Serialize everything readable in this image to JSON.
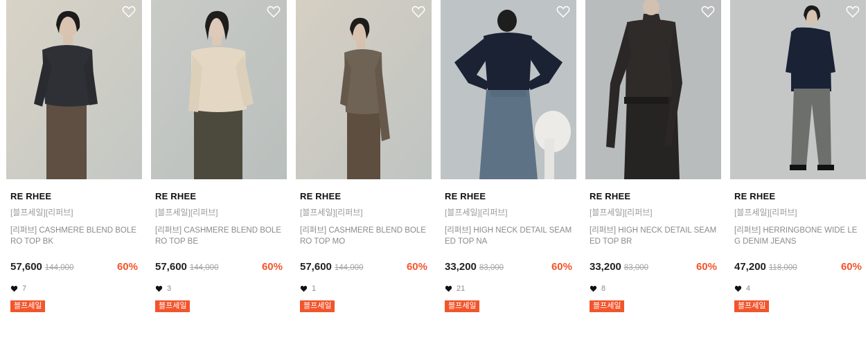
{
  "products": [
    {
      "brand": "RE RHEE",
      "tag": "[블프세일][리퍼브]",
      "name": "[리퍼브] CASHMERE BLEND BOLERO TOP BK",
      "price": "57,600",
      "original": "144,000",
      "rate": "60%",
      "likes": "7",
      "badge": "블프세일"
    },
    {
      "brand": "RE RHEE",
      "tag": "[블프세일][리퍼브]",
      "name": "[리퍼브] CASHMERE BLEND BOLERO TOP BE",
      "price": "57,600",
      "original": "144,000",
      "rate": "60%",
      "likes": "3",
      "badge": "블프세일"
    },
    {
      "brand": "RE RHEE",
      "tag": "[블프세일][리퍼브]",
      "name": "[리퍼브] CASHMERE BLEND BOLERO TOP MO",
      "price": "57,600",
      "original": "144,000",
      "rate": "60%",
      "likes": "1",
      "badge": "블프세일"
    },
    {
      "brand": "RE RHEE",
      "tag": "[블프세일][리퍼브]",
      "name": "[리퍼브] HIGH NECK DETAIL SEAMED TOP NA",
      "price": "33,200",
      "original": "83,000",
      "rate": "60%",
      "likes": "21",
      "badge": "블프세일"
    },
    {
      "brand": "RE RHEE",
      "tag": "[블프세일][리퍼브]",
      "name": "[리퍼브] HIGH NECK DETAIL SEAMED TOP BR",
      "price": "33,200",
      "original": "83,000",
      "rate": "60%",
      "likes": "8",
      "badge": "블프세일"
    },
    {
      "brand": "RE RHEE",
      "tag": "[블프세일][리퍼브]",
      "name": "[리퍼브] HERRINGBONE WIDE LEG DENIM JEANS",
      "price": "47,200",
      "original": "118,000",
      "rate": "60%",
      "likes": "4",
      "badge": "블프세일"
    }
  ],
  "colors": {
    "accent": "#f2552c"
  },
  "icons": {
    "wishlist": "heart-outline-icon",
    "likes": "heart-filled-icon"
  }
}
